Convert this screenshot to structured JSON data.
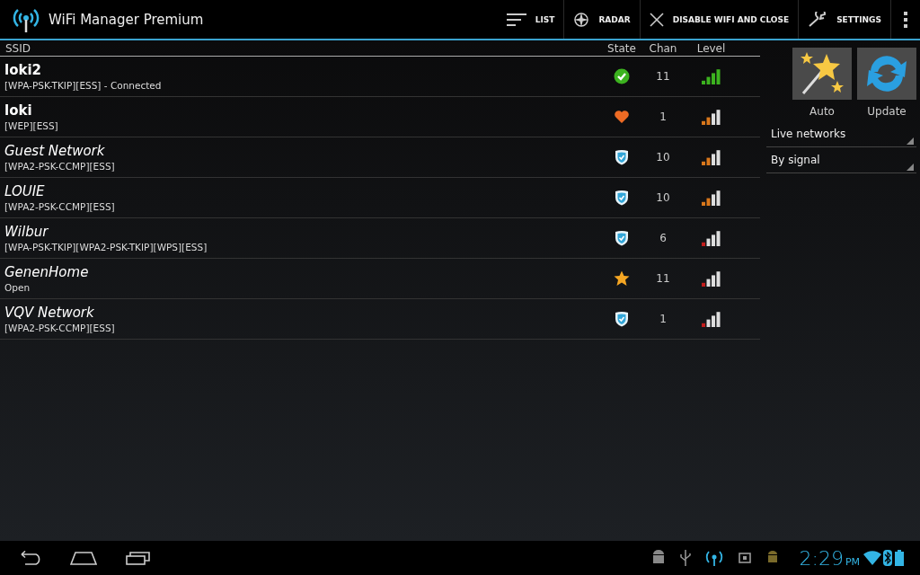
{
  "app_bar": {
    "title": "WiFi Manager Premium",
    "actions": [
      "LIST",
      "RADAR",
      "DISABLE WIFI AND CLOSE",
      "SETTINGS"
    ]
  },
  "table": {
    "columns": [
      "SSID",
      "State",
      "Chan",
      "Level"
    ],
    "rows": [
      {
        "ssid": "loki2",
        "details": "[WPA-PSK-TKIP][ESS] - Connected",
        "known": true,
        "state_icon": {
          "kind": "connected"
        },
        "chan": "11",
        "signal_icon": {
          "kind": "excellent"
        }
      },
      {
        "ssid": "loki",
        "details": "[WEP][ESS]",
        "known": true,
        "state_icon": {
          "kind": "favorite"
        },
        "chan": "1",
        "signal_icon": {
          "kind": "fair"
        }
      },
      {
        "ssid": "Guest Network",
        "details": "[WPA2-PSK-CCMP][ESS]",
        "known": false,
        "state_icon": {
          "kind": "secured"
        },
        "chan": "10",
        "signal_icon": {
          "kind": "fair"
        }
      },
      {
        "ssid": "LOUIE",
        "details": "[WPA2-PSK-CCMP][ESS]",
        "known": false,
        "state_icon": {
          "kind": "secured"
        },
        "chan": "10",
        "signal_icon": {
          "kind": "fair"
        }
      },
      {
        "ssid": "Wilbur",
        "details": "[WPA-PSK-TKIP][WPA2-PSK-TKIP][WPS][ESS]",
        "known": false,
        "state_icon": {
          "kind": "secured"
        },
        "chan": "6",
        "signal_icon": {
          "kind": "weak"
        }
      },
      {
        "ssid": "GenenHome",
        "details": "Open",
        "known": false,
        "state_icon": {
          "kind": "open"
        },
        "chan": "11",
        "signal_icon": {
          "kind": "weak"
        }
      },
      {
        "ssid": "VQV Network",
        "details": "[WPA2-PSK-CCMP][ESS]",
        "known": false,
        "state_icon": {
          "kind": "secured"
        },
        "chan": "1",
        "signal_icon": {
          "kind": "weak"
        }
      }
    ]
  },
  "side_panel": {
    "buttons": [
      {
        "kind": "auto",
        "label": "Auto"
      },
      {
        "kind": "update",
        "label": "Update"
      }
    ],
    "dropdowns": [
      "Live networks",
      "By signal"
    ]
  },
  "status_bar": {
    "time": "2:29",
    "ampm": "PM"
  }
}
